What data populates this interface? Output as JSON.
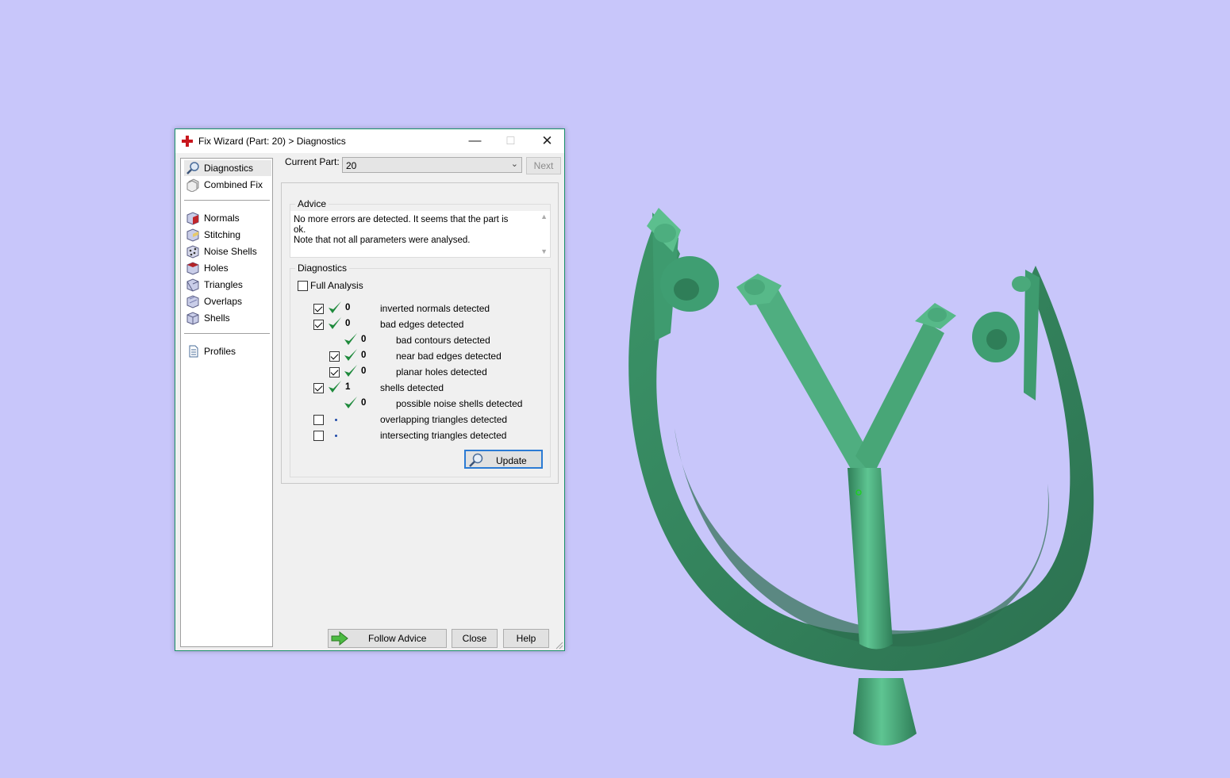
{
  "window": {
    "title": "Fix Wizard (Part: 20) > Diagnostics"
  },
  "nav": {
    "items": [
      {
        "label": "Diagnostics",
        "icon": "magnifier-icon"
      },
      {
        "label": "Combined Fix",
        "icon": "cube-stack-icon"
      },
      {
        "label": "Normals",
        "icon": "normals-cube-icon"
      },
      {
        "label": "Stitching",
        "icon": "stitching-cube-icon"
      },
      {
        "label": "Noise Shells",
        "icon": "noise-shells-icon"
      },
      {
        "label": "Holes",
        "icon": "holes-cube-icon"
      },
      {
        "label": "Triangles",
        "icon": "triangles-cube-icon"
      },
      {
        "label": "Overlaps",
        "icon": "overlaps-cube-icon"
      },
      {
        "label": "Shells",
        "icon": "shells-cube-icon"
      },
      {
        "label": "Profiles",
        "icon": "document-icon"
      }
    ]
  },
  "current_part": {
    "label": "Current Part:",
    "value": "20",
    "next_label": "Next"
  },
  "advice": {
    "title": "Advice",
    "line1": "No more errors are detected. It seems that the part is ok.",
    "line2": "Note that not all parameters were analysed."
  },
  "diagnostics": {
    "title": "Diagnostics",
    "full_analysis_label": "Full Analysis",
    "rows": [
      {
        "checked": true,
        "count": "0",
        "label": "inverted normals detected"
      },
      {
        "checked": true,
        "count": "0",
        "label": "bad edges detected"
      },
      {
        "checked": null,
        "count": "0",
        "label": "bad contours detected"
      },
      {
        "checked": true,
        "count": "0",
        "label": "near bad edges detected"
      },
      {
        "checked": true,
        "count": "0",
        "label": "planar holes detected"
      },
      {
        "checked": true,
        "count": "1",
        "label": "shells detected"
      },
      {
        "checked": null,
        "count": "0",
        "label": "possible noise shells detected"
      },
      {
        "checked": false,
        "count": "",
        "label": "overlapping triangles detected"
      },
      {
        "checked": false,
        "count": "",
        "label": "intersecting triangles detected"
      }
    ],
    "update_label": "Update"
  },
  "footer": {
    "follow_label": "Follow Advice",
    "close_label": "Close",
    "help_label": "Help"
  },
  "colors": {
    "background": "#c8c6fa",
    "model_green": "#3f9e72",
    "check_green": "#1e8a3c"
  }
}
